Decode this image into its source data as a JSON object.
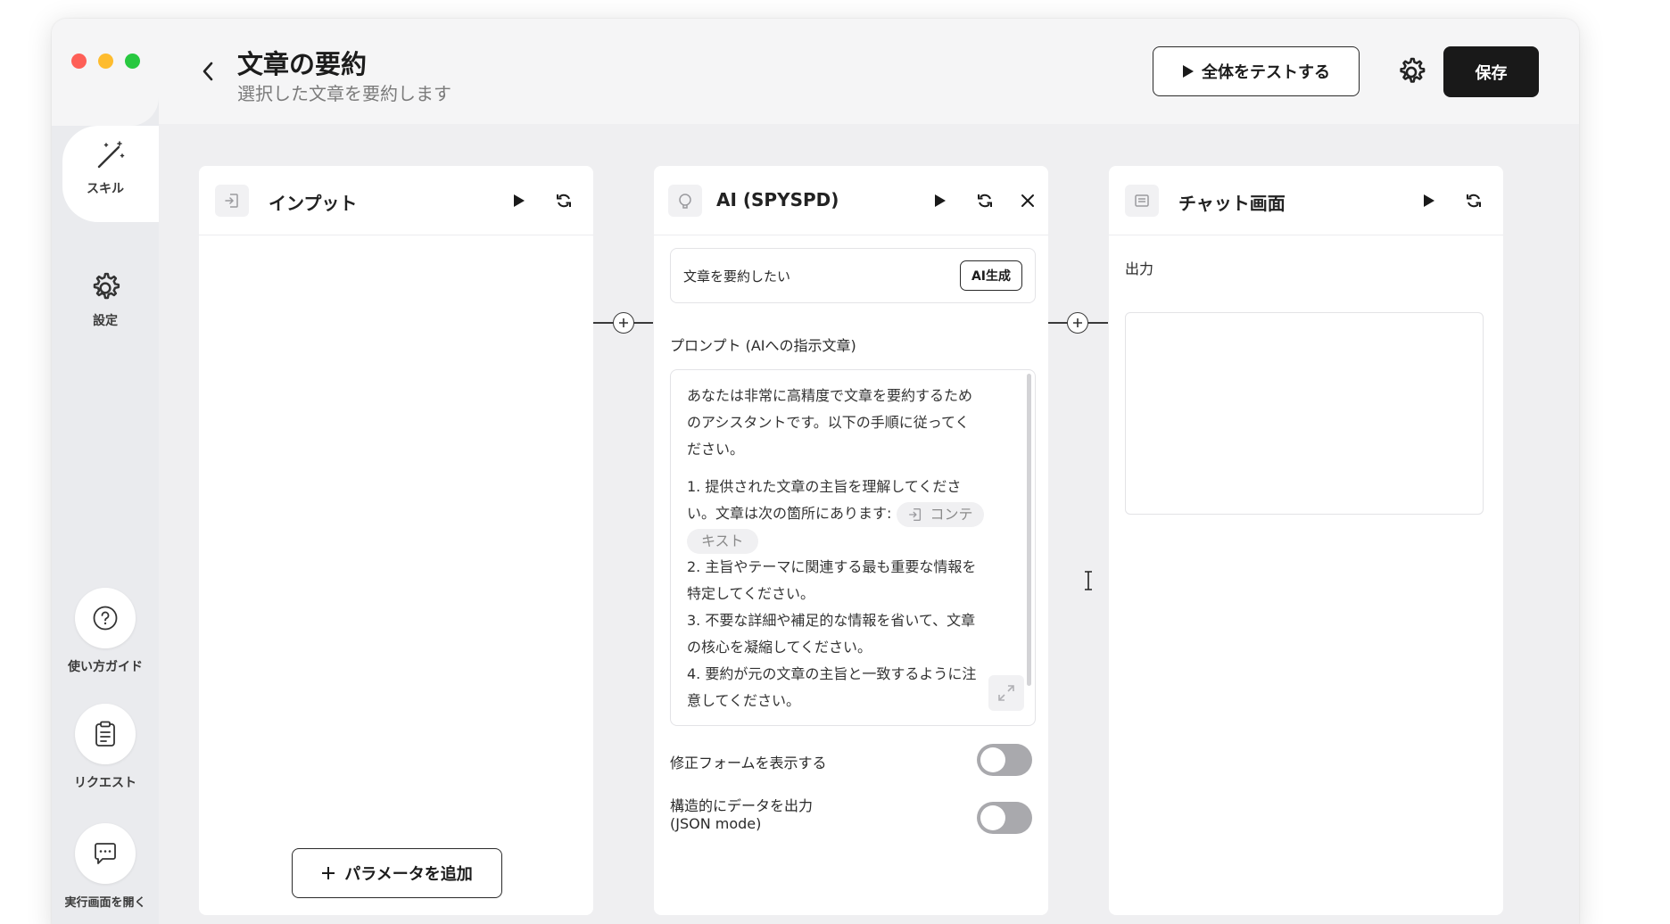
{
  "window": {
    "title": "文章の要約",
    "subtitle": "選択した文章を要約します"
  },
  "header": {
    "test_all_label": "全体をテストする",
    "save_label": "保存"
  },
  "sidebar": {
    "items": [
      {
        "label": "スキル",
        "icon": "magic-wand-icon",
        "active": true
      },
      {
        "label": "設定",
        "icon": "gear-icon",
        "active": false
      }
    ],
    "bottom": [
      {
        "label": "使い方ガイド",
        "icon": "help-icon"
      },
      {
        "label": "リクエスト",
        "icon": "clipboard-icon"
      },
      {
        "label": "実行画面を開く",
        "icon": "chat-icon"
      }
    ]
  },
  "nodes": {
    "input": {
      "title": "インプット",
      "add_param_label": "パラメータを追加"
    },
    "ai": {
      "title": "AI (SPYSPD)",
      "request_text": "文章を要約したい",
      "ai_gen_label": "AI生成",
      "prompt_label": "プロンプト (AIへの指示文章)",
      "prompt_intro": [
        "あなたは非常に高精度で文章を要約するため",
        "のアシスタントです。以下の手順に従ってく",
        "ださい。"
      ],
      "step1_a": "1. 提供された文章の主旨を理解してくださ",
      "step1_b": "い。文章は次の箇所にあります:",
      "chip_a": "コンテ",
      "chip_b": "キスト",
      "step2_a": "2. 主旨やテーマに関連する最も重要な情報を",
      "step2_b": "特定してください。",
      "step3_a": "3. 不要な詳細や補足的な情報を省いて、文章",
      "step3_b": "の核心を凝縮してください。",
      "step4_a": "4. 要約が元の文章の主旨と一致するように注",
      "step4_b": "意してください。",
      "toggle1_label": "修正フォームを表示する",
      "toggle2_label_a": "構造的にデータを出力",
      "toggle2_label_b": "(JSON mode)",
      "toggle1_on": false,
      "toggle2_on": false
    },
    "chat": {
      "title": "チャット画面",
      "output_label": "出力"
    }
  },
  "colors": {
    "accent_dark": "#191919",
    "traffic_red": "#fe5f57",
    "traffic_yellow": "#febc2e",
    "traffic_green": "#28c840",
    "toggle_off": "#a9a9ad"
  }
}
